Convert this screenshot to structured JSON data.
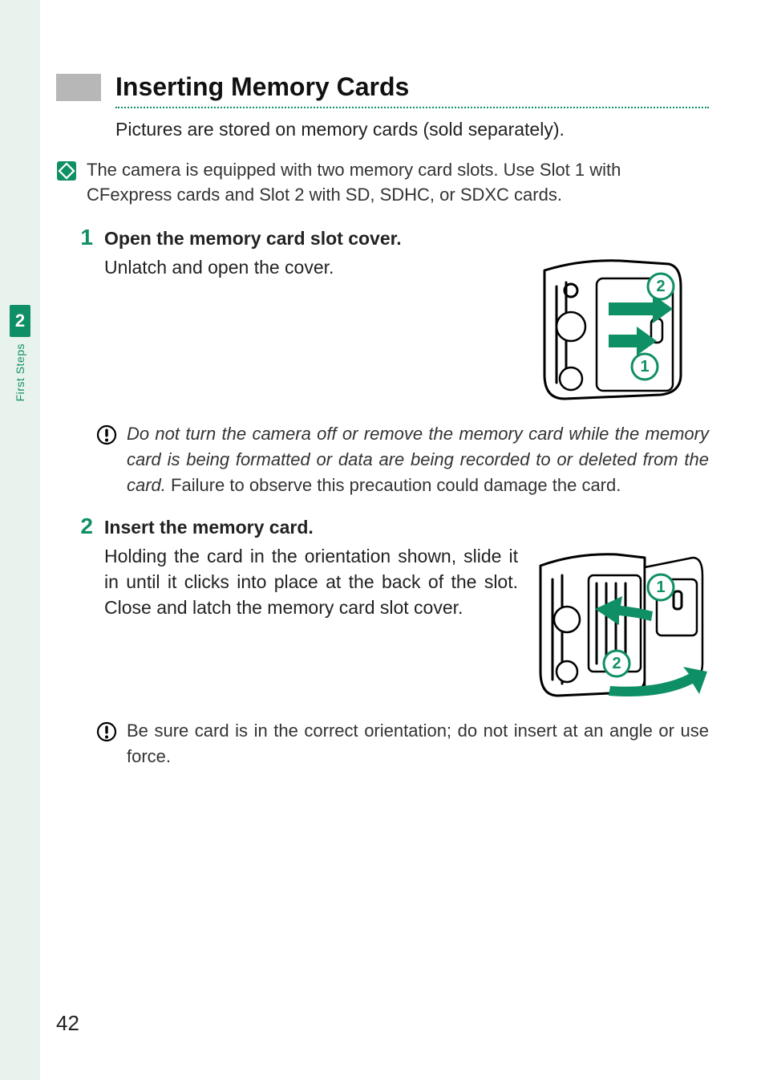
{
  "sidebar": {
    "chapter_number": "2",
    "chapter_label": "First Steps"
  },
  "heading": "Inserting Memory Cards",
  "intro": "Pictures are stored on memory cards (sold separately).",
  "tip_note": "The camera is equipped with two memory card slots. Use Slot 1 with CFexpress cards and Slot 2 with SD, SDHC, or SDXC cards.",
  "steps": [
    {
      "num": "1",
      "title": "Open the memory card slot cover.",
      "text": "Unlatch and open the cover.",
      "caution_italic": "Do not turn the camera off or remove the memory card while the memory card is being formatted or data are being recorded to or deleted from the card.",
      "caution_plain": " Failure to observe this precaution could damage the card.",
      "img_labels": {
        "a": "1",
        "b": "2"
      }
    },
    {
      "num": "2",
      "title": "Insert the memory card.",
      "text": "Holding the card in the orientation shown, slide it in until it clicks into place at the back of the slot. Close and latch the memory card slot cover.",
      "caution_plain": "Be sure card is in the correct orientation; do not insert at an angle or use force.",
      "img_labels": {
        "a": "1",
        "b": "2"
      }
    }
  ],
  "page_number": "42"
}
